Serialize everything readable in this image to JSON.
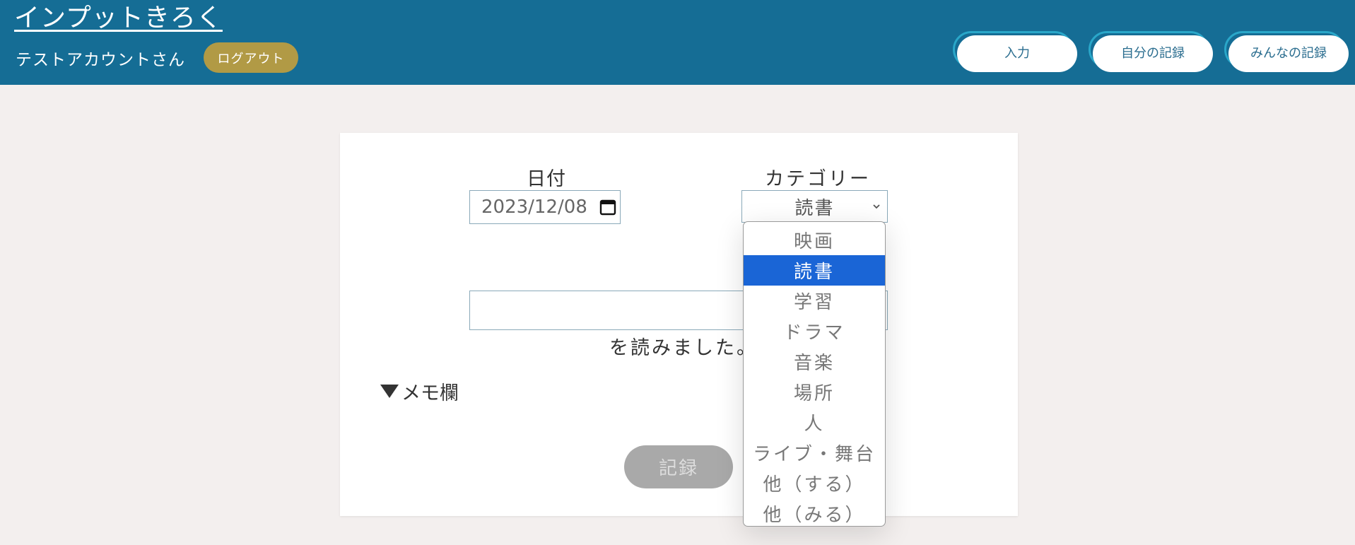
{
  "header": {
    "app_title": "インプットきろく",
    "user_name": "テストアカウントさん",
    "logout_label": "ログアウト",
    "nav": [
      "入力",
      "自分の記録",
      "みんなの記録"
    ]
  },
  "form": {
    "date_label": "日付",
    "date_value": "2023/12/08",
    "category_label": "カテゴリー",
    "category_value": "読書",
    "title_value": "",
    "suffix_text": "を読みました。",
    "memo_toggle": "メモ欄",
    "submit_label": "記録"
  },
  "dropdown": {
    "options": [
      "映画",
      "読書",
      "学習",
      "ドラマ",
      "音楽",
      "場所",
      "人",
      "ライブ・舞台",
      "他（する）",
      "他（みる）"
    ],
    "selected_index": 1
  },
  "colors": {
    "header_bg": "#156d95",
    "logout_bg": "#b19a45",
    "nav_ring": "#2aa7c9",
    "selected_option": "#1a65d6",
    "submit_disabled": "#a9a9a9"
  },
  "icons": {
    "date_picker": "calendar-icon",
    "select_arrow": "chevron-down-icon",
    "memo_toggle": "triangle-down-icon"
  }
}
